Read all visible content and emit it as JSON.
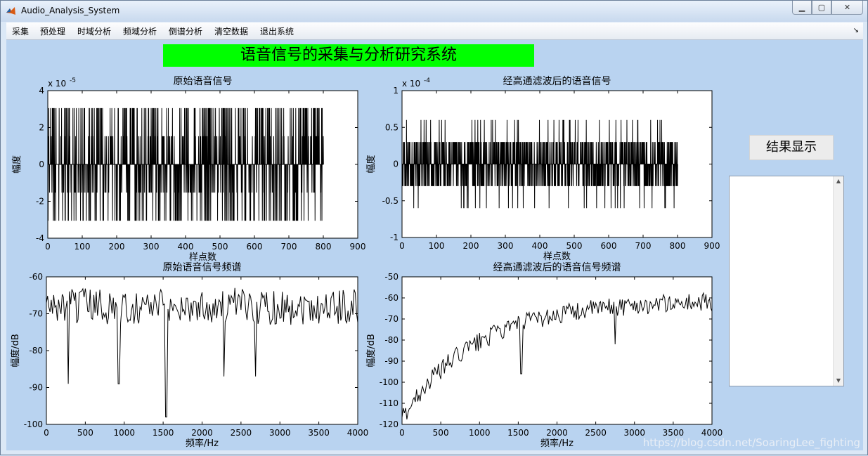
{
  "window": {
    "title": "Audio_Analysis_System"
  },
  "menu": [
    "采集",
    "预处理",
    "时域分析",
    "频域分析",
    "倒谱分析",
    "清空数据",
    "退出系统"
  ],
  "banner": "语音信号的采集与分析研究系统",
  "result_button": "结果显示",
  "watermark": "https://blog.csdn.net/SoaringLee_fighting",
  "chart_data": [
    {
      "type": "line",
      "title": "原始语音信号",
      "xlabel": "样点数",
      "ylabel": "幅度",
      "exponent": "x 10",
      "exponent_power": "-5",
      "xlim": [
        0,
        900
      ],
      "ylim": [
        -4,
        4
      ],
      "xticks": [
        0,
        100,
        200,
        300,
        400,
        500,
        600,
        700,
        800,
        900
      ],
      "yticks": [
        -4,
        -2,
        0,
        2,
        4
      ],
      "series": [
        {
          "style": "quantized-spikes",
          "levels": [
            3.05,
            1.53,
            -1.53,
            -3.05
          ],
          "x_range": [
            0,
            800
          ]
        }
      ]
    },
    {
      "type": "line",
      "title": "经高通滤波后的语音信号",
      "xlabel": "样点数",
      "ylabel": "幅度",
      "exponent": "x 10",
      "exponent_power": "-4",
      "xlim": [
        0,
        900
      ],
      "ylim": [
        -1,
        1
      ],
      "xticks": [
        0,
        100,
        200,
        300,
        400,
        500,
        600,
        700,
        800,
        900
      ],
      "yticks": [
        -1,
        -0.5,
        0,
        0.5,
        1
      ],
      "series": [
        {
          "style": "filtered-spikes",
          "levels": [
            0.6,
            0.3,
            -0.3,
            -0.6
          ],
          "x_range": [
            0,
            800
          ]
        }
      ]
    },
    {
      "type": "line",
      "title": "原始语音信号频谱",
      "xlabel": "频率/Hz",
      "ylabel": "幅度/dB",
      "xlim": [
        0,
        4000
      ],
      "ylim": [
        -100,
        -60
      ],
      "xticks": [
        0,
        500,
        1000,
        1500,
        2000,
        2500,
        3000,
        3500,
        4000
      ],
      "yticks": [
        -100,
        -90,
        -80,
        -70,
        -60
      ],
      "series": [
        {
          "style": "noise-spectrum",
          "mean": -68,
          "dips": [
            [
              280,
              -89
            ],
            [
              930,
              -89
            ],
            [
              1540,
              -98
            ],
            [
              2280,
              -87
            ],
            [
              2690,
              -87
            ]
          ]
        }
      ]
    },
    {
      "type": "line",
      "title": "经高通滤波后的语音信号频谱",
      "xlabel": "频率/Hz",
      "ylabel": "幅度/dB",
      "xlim": [
        0,
        4000
      ],
      "ylim": [
        -120,
        -50
      ],
      "xticks": [
        0,
        500,
        1000,
        1500,
        2000,
        2500,
        3000,
        3500,
        4000
      ],
      "yticks": [
        -120,
        -110,
        -100,
        -90,
        -80,
        -70,
        -60,
        -50
      ],
      "series": [
        {
          "style": "rising-spectrum",
          "start": -117,
          "end": -62,
          "dips": [
            [
              270,
              -102
            ],
            [
              1540,
              -96
            ],
            [
              2750,
              -82
            ]
          ]
        }
      ]
    }
  ]
}
